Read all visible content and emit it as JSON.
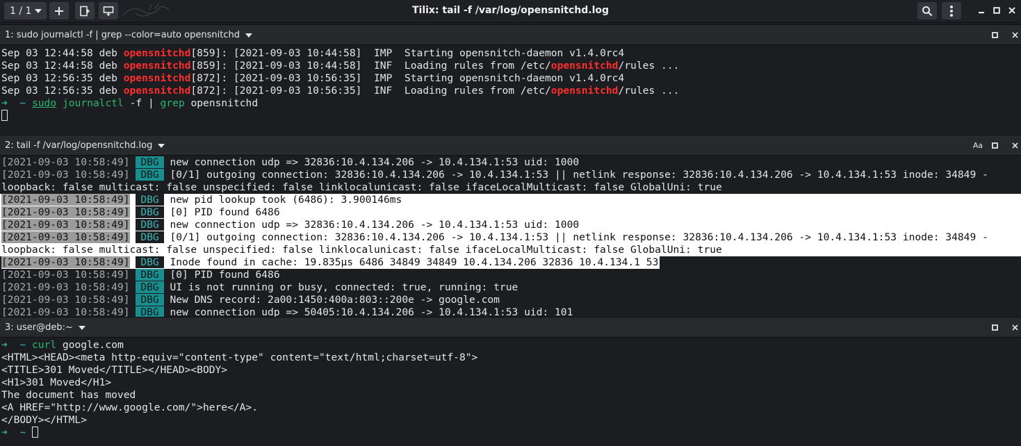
{
  "window": {
    "title": "Tilix: tail -f /var/log/opensnitchd.log",
    "session_label": "1 / 1",
    "icons": {
      "add": "plus-icon",
      "add_right": "split-right-icon",
      "add_down": "split-down-icon",
      "search": "search-icon",
      "menu": "kebab-menu-icon",
      "minimize": "minimize-icon",
      "maximize": "maximize-icon",
      "close": "close-icon"
    }
  },
  "panes": [
    {
      "title": "1: sudo journalctl -f | grep --color=auto  opensnitchd",
      "lines": [
        {
          "pre": "Sep 03 12:44:58 deb ",
          "hl": "opensnitchd",
          "post": "[859]: [2021-09-03 10:44:58]  IMP  Starting opensnitch-daemon v1.4.0rc4"
        },
        {
          "pre": "Sep 03 12:44:58 deb ",
          "hl": "opensnitchd",
          "post": "[859]: [2021-09-03 10:44:58]  INF  Loading rules from /etc/",
          "hl2": "opensnitchd",
          "post2": "/rules ..."
        },
        {
          "pre": "Sep 03 12:56:35 deb ",
          "hl": "opensnitchd",
          "post": "[872]: [2021-09-03 10:56:35]  IMP  Starting opensnitch-daemon v1.4.0rc4"
        },
        {
          "pre": "Sep 03 12:56:35 deb ",
          "hl": "opensnitchd",
          "post": "[872]: [2021-09-03 10:56:35]  INF  Loading rules from /etc/",
          "hl2": "opensnitchd",
          "post2": "/rules ..."
        }
      ],
      "prompt": {
        "arrow": "➜",
        "dir": "~",
        "cmd1": "sudo",
        "cmd2": "journalctl",
        "args": " -f | ",
        "cmd3": "grep",
        "args2": " opensnitchd"
      }
    },
    {
      "title": "2: tail -f /var/log/opensnitchd.log",
      "text_icon": "Aa",
      "lines": [
        {
          "ts": "[2021-09-03 10:58:49]",
          "lvl": "DBG",
          "msg": "new connection udp => 32836:10.4.134.206 -> 10.4.134.1:53 uid: 1000"
        },
        {
          "ts": "[2021-09-03 10:58:49]",
          "lvl": "DBG",
          "msg": "[0/1] outgoing connection: 32836:10.4.134.206 -> 10.4.134.1:53 || netlink response: 32836:10.4.134.206 -> 10.4.134.1:53 inode: 34849 -"
        },
        {
          "wrap": "loopback: false multicast: false unspecified: false linklocalunicast: false ifaceLocalMulticast: false GlobalUni: true"
        },
        {
          "ts": "[2021-09-03 10:58:49]",
          "lvl": "DBG",
          "msg": "new pid lookup took (6486): 3.900146ms"
        },
        {
          "ts": "[2021-09-03 10:58:49]",
          "lvl": "DBG",
          "msg": "[0] PID found 6486"
        },
        {
          "ts": "[2021-09-03 10:58:49]",
          "lvl": "DBG",
          "msg": "new connection udp => 32836:10.4.134.206 -> 10.4.134.1:53 uid: 1000"
        },
        {
          "ts": "[2021-09-03 10:58:49]",
          "lvl": "DBG",
          "msg": "[0/1] outgoing connection: 32836:10.4.134.206 -> 10.4.134.1:53 || netlink response: 32836:10.4.134.206 -> 10.4.134.1:53 inode: 34849 -"
        },
        {
          "wrap": "loopback: false multicast: false unspecified: false linklocalunicast: false ifaceLocalMulticast: false GlobalUni: true"
        },
        {
          "ts": "[2021-09-03 10:58:49]",
          "lvl": "DBG",
          "msg": "Inode found in cache: 19.835µs 6486 34849 34849 10.4.134.206 32836 10.4.134.1 53"
        },
        {
          "ts": "[2021-09-03 10:58:49]",
          "lvl": "DBG",
          "msg": "[0] PID found 6486"
        },
        {
          "ts": "[2021-09-03 10:58:49]",
          "lvl": "DBG",
          "msg": "UI is not running or busy, connected: true, running: true"
        },
        {
          "ts": "[2021-09-03 10:58:49]",
          "lvl": "DBG",
          "msg": "New DNS record: 2a00:1450:400a:803::200e -> google.com"
        },
        {
          "ts": "[2021-09-03 10:58:49]",
          "lvl": "DBG",
          "msg": "new connection udp => 50405:10.4.134.206 -> 10.4.134.1:53 uid: 101"
        }
      ]
    },
    {
      "title": "3: user@deb:~",
      "prompt": {
        "arrow": "➜",
        "dir": "~",
        "cmd": "curl",
        "args": " google.com"
      },
      "lines": [
        "<HTML><HEAD><meta http-equiv=\"content-type\" content=\"text/html;charset=utf-8\">",
        "<TITLE>301 Moved</TITLE></HEAD><BODY>",
        "<H1>301 Moved</H1>",
        "The document has moved",
        "<A HREF=\"http://www.google.com/\">here</A>.",
        "</BODY></HTML>"
      ],
      "prompt2": {
        "arrow": "➜",
        "dir": "~"
      }
    }
  ]
}
